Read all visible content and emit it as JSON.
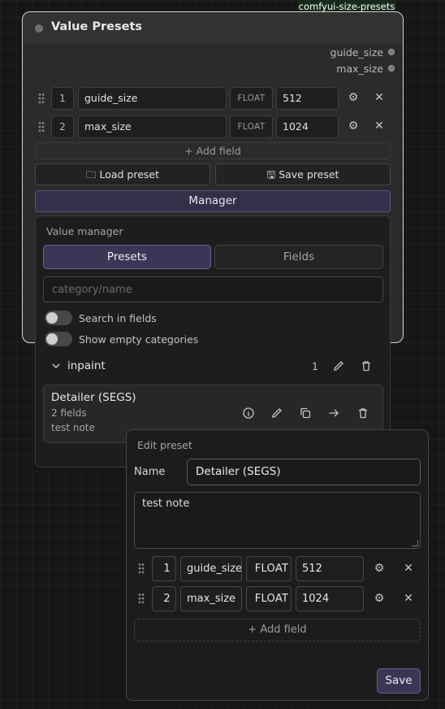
{
  "node_badge": "comfyui-size-presets",
  "node": {
    "title": "Value Presets",
    "outputs": [
      "guide_size",
      "max_size"
    ],
    "fields": [
      {
        "index": "1",
        "name": "guide_size",
        "type": "FLOAT",
        "value": "512"
      },
      {
        "index": "2",
        "name": "max_size",
        "type": "FLOAT",
        "value": "1024"
      }
    ],
    "add_field_label": "+ Add field",
    "load_preset_label": "Load preset",
    "save_preset_label": "Save preset",
    "manager_label": "Manager"
  },
  "manager": {
    "title": "Value manager",
    "tabs": {
      "presets": "Presets",
      "fields": "Fields"
    },
    "search_placeholder": "category/name",
    "toggles": {
      "search_in_fields": "Search in fields",
      "show_empty": "Show empty categories"
    },
    "category": {
      "name": "inpaint",
      "count": "1"
    },
    "preset": {
      "name": "Detailer (SEGS)",
      "fields_count": "2 fields",
      "note": "test note"
    }
  },
  "edit_preset": {
    "title": "Edit preset",
    "name_label": "Name",
    "name_value": "Detailer (SEGS)",
    "note_value": "test note",
    "fields": [
      {
        "index": "1",
        "name": "guide_size",
        "type": "FLOAT",
        "value": "512"
      },
      {
        "index": "2",
        "name": "max_size",
        "type": "FLOAT",
        "value": "1024"
      }
    ],
    "add_field_label": "+ Add field",
    "save_label": "Save"
  },
  "colors": {
    "accent": "#3a3656",
    "accent_border": "#68628f",
    "badge_bg": "#152a1a"
  }
}
